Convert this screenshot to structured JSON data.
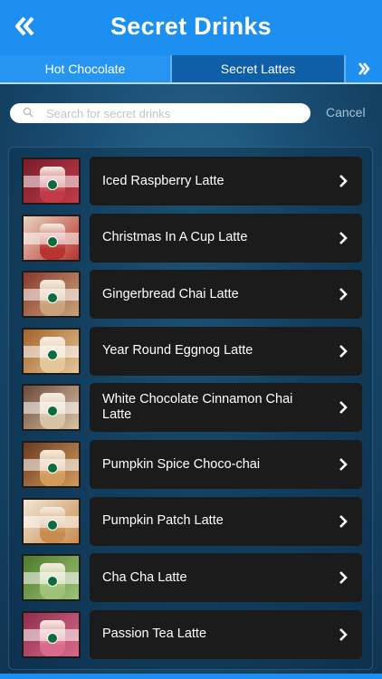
{
  "header": {
    "title": "Secret Drinks",
    "back_icon": "double-chevron-left-icon"
  },
  "tabs": {
    "items": [
      {
        "label": "Hot Chocolate",
        "selected": false
      },
      {
        "label": "Secret Lattes",
        "selected": true
      }
    ],
    "next_icon": "double-chevron-right-icon"
  },
  "search": {
    "placeholder": "Search for secret drinks",
    "value": "",
    "cancel_label": "Cancel"
  },
  "drinks": [
    {
      "label": "Iced Raspberry Latte",
      "thumb_colors": [
        "#c23a4a",
        "#7a1d2a"
      ]
    },
    {
      "label": "Christmas In A Cup Latte",
      "thumb_colors": [
        "#b8332e",
        "#e8d4c0"
      ]
    },
    {
      "label": "Gingerbread Chai Latte",
      "thumb_colors": [
        "#c9a27a",
        "#8a3a2c"
      ]
    },
    {
      "label": "Year Round Eggnog Latte",
      "thumb_colors": [
        "#e3c79a",
        "#a4622b"
      ]
    },
    {
      "label": "White Chocolate Cinnamon Chai Latte",
      "thumb_colors": [
        "#d9c3a6",
        "#6b4a3a"
      ]
    },
    {
      "label": "Pumpkin Spice Choco-chai",
      "thumb_colors": [
        "#d49a5c",
        "#6a3b22"
      ]
    },
    {
      "label": "Pumpkin Patch Latte",
      "thumb_colors": [
        "#c88c4e",
        "#f1e6d6"
      ]
    },
    {
      "label": "Cha Cha Latte",
      "thumb_colors": [
        "#9fc276",
        "#4d7a2c"
      ]
    },
    {
      "label": "Passion Tea Latte",
      "thumb_colors": [
        "#d86a8a",
        "#8f2e4c"
      ]
    }
  ],
  "colors": {
    "accent": "#1d8ff0",
    "selected_tab": "#0f5fa8",
    "card": "#1b1b1b"
  }
}
